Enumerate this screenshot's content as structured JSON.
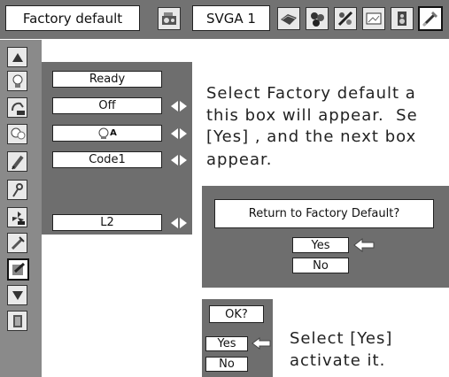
{
  "topbar": {
    "title": "Factory default",
    "source": "SVGA 1",
    "icons": [
      "projector-icon",
      "disc-icon",
      "palette-icon",
      "image-adjust-icon",
      "screen-icon",
      "speaker-icon",
      "wrench-icon"
    ]
  },
  "sidebar": {
    "items": [
      "up-arrow-icon",
      "lamp-icon",
      "power-on-icon",
      "lamp-mode-icon",
      "pencil-icon",
      "key-icon",
      "fan-off-icon",
      "settings-icon",
      "factory-default-icon",
      "down-arrow-icon",
      "exit-icon"
    ]
  },
  "panel": {
    "rows": [
      {
        "value": "Ready"
      },
      {
        "value": "Off"
      },
      {
        "value": "A"
      },
      {
        "value": "Code1"
      },
      {
        "value": "L2"
      }
    ]
  },
  "instructions": {
    "line1": "Select Factory default a",
    "line2": "this box will appear.  Se",
    "line3": "[Yes] , and the next box",
    "line4": "appear.",
    "bottom_line1": "Select [Yes]",
    "bottom_line2": "activate it."
  },
  "dialog": {
    "question": "Return to Factory Default?",
    "yes": "Yes",
    "no": "No"
  },
  "confirm": {
    "question": "OK?",
    "yes": "Yes",
    "no": "No"
  },
  "colors": {
    "panel_gray": "#6e6e6e",
    "topbar_gray": "#727272",
    "sidebar_gray": "#8a8a8a"
  }
}
